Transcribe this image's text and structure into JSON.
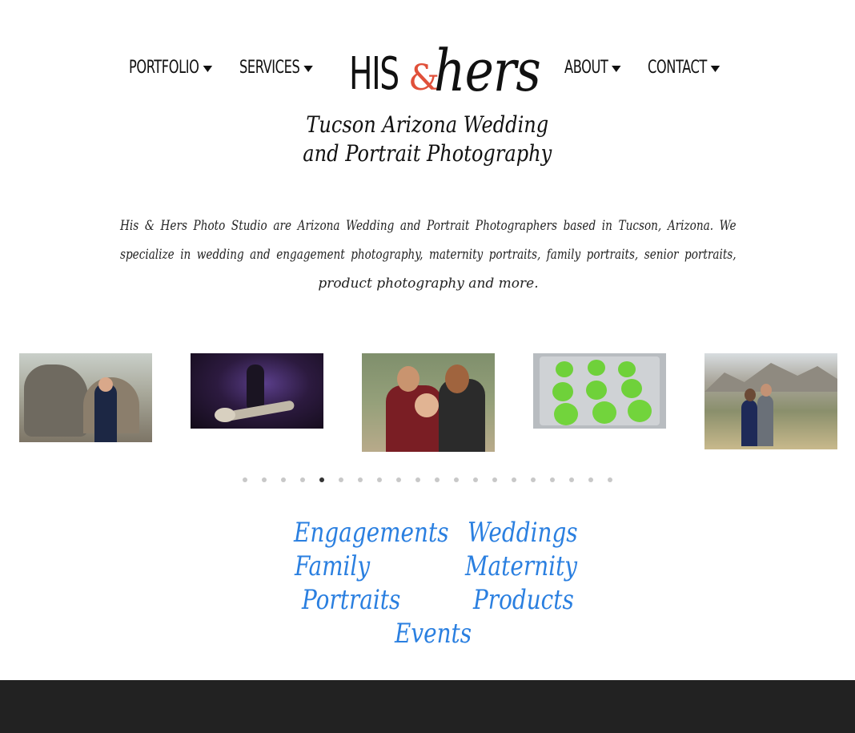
{
  "nav": {
    "left": [
      {
        "label": "PORTFOLIO"
      },
      {
        "label": "SERVICES"
      }
    ],
    "right": [
      {
        "label": "ABOUT"
      },
      {
        "label": "CONTACT"
      }
    ]
  },
  "logo": {
    "his": "HIS",
    "amp": "&",
    "hers": "hers"
  },
  "tagline": {
    "line1": "Tucson Arizona Wedding",
    "line2": "and Portrait Photography"
  },
  "intro": {
    "line1": "His & Hers Photo Studio are Arizona Wedding and Portrait Photographers based in Tucson, Arizona. We",
    "line2": "specialize in wedding and engagement photography, maternity portraits, family portraits, senior portraits,",
    "line3": "product photography and more."
  },
  "slider": {
    "dot_count": 20,
    "active_index": 4
  },
  "categories": {
    "engagements": "Engagements",
    "weddings": "Weddings",
    "family": "Family",
    "maternity": "Maternity",
    "portraits": "Portraits",
    "products": "Products",
    "events": "Events"
  },
  "colors": {
    "accent": "#2a7fe0",
    "logo_amp": "#e0503a",
    "footer": "#222222"
  }
}
